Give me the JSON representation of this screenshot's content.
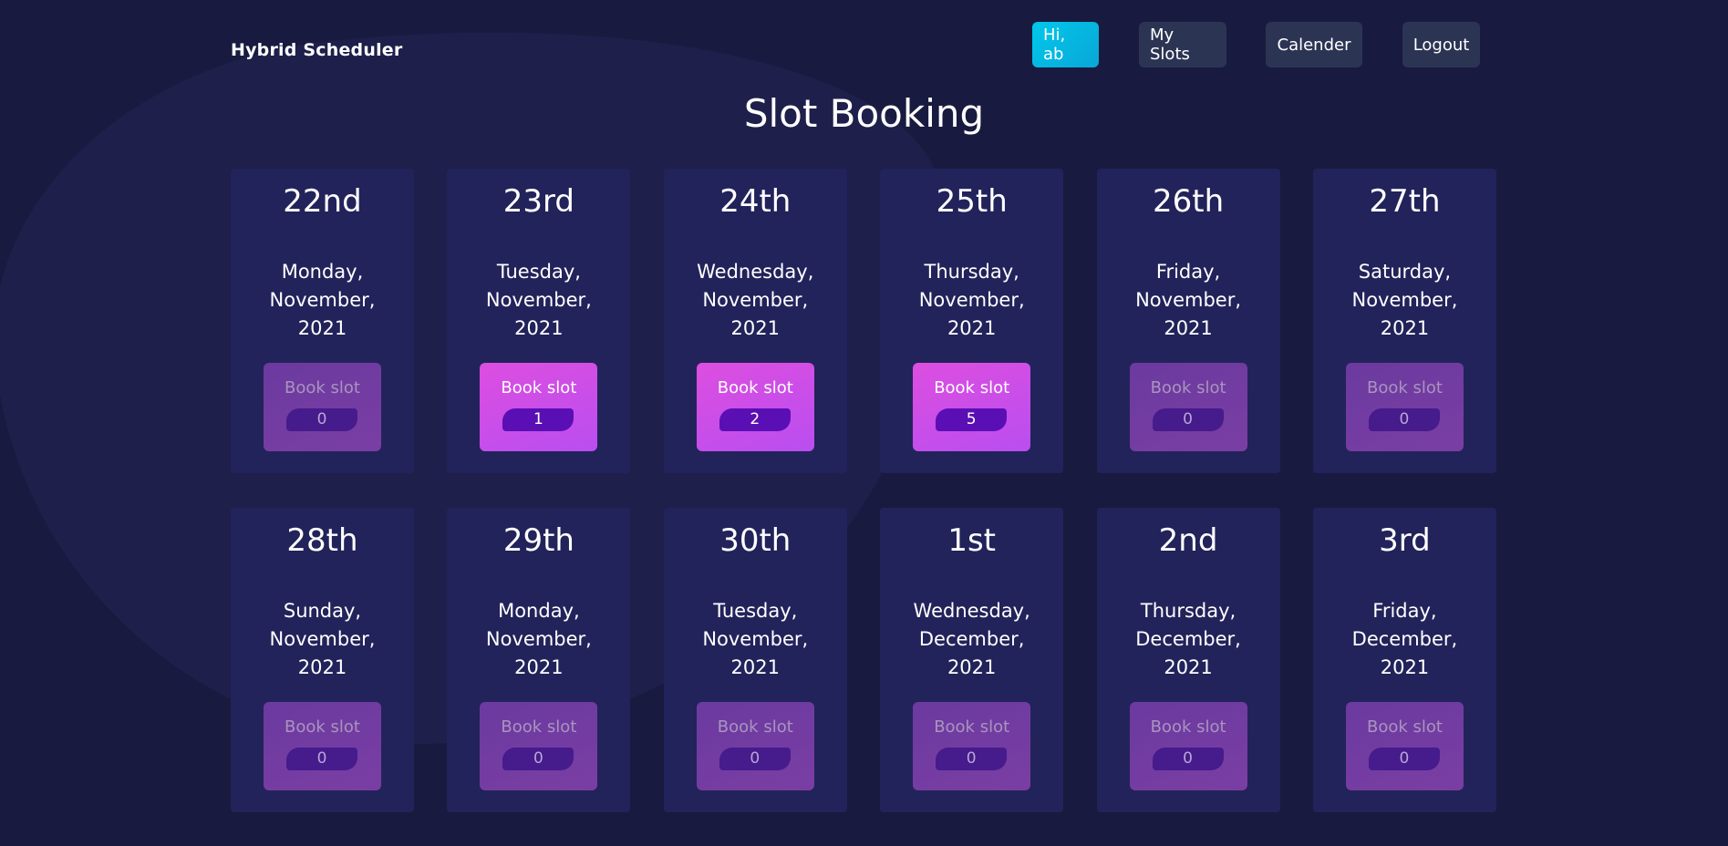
{
  "header": {
    "brand": "Hybrid Scheduler",
    "greeting": "Hi, ab",
    "my_slots": "My Slots",
    "calendar": "Calender",
    "logout": "Logout"
  },
  "page_title": "Slot Booking",
  "book_label": "Book slot",
  "colors": {
    "background": "#191a3f",
    "card": "#22235a",
    "greet_accent": "#00c8ea",
    "book_active": "#dd4ee0",
    "book_inactive": "#6b3aa0"
  },
  "days": [
    {
      "day": "22nd",
      "weekday": "Monday,",
      "month": "November,",
      "year": "2021",
      "count": "0",
      "active": false
    },
    {
      "day": "23rd",
      "weekday": "Tuesday,",
      "month": "November,",
      "year": "2021",
      "count": "1",
      "active": true
    },
    {
      "day": "24th",
      "weekday": "Wednesday,",
      "month": "November,",
      "year": "2021",
      "count": "2",
      "active": true
    },
    {
      "day": "25th",
      "weekday": "Thursday,",
      "month": "November,",
      "year": "2021",
      "count": "5",
      "active": true
    },
    {
      "day": "26th",
      "weekday": "Friday,",
      "month": "November,",
      "year": "2021",
      "count": "0",
      "active": false
    },
    {
      "day": "27th",
      "weekday": "Saturday,",
      "month": "November,",
      "year": "2021",
      "count": "0",
      "active": false
    },
    {
      "day": "28th",
      "weekday": "Sunday,",
      "month": "November,",
      "year": "2021",
      "count": "0",
      "active": false
    },
    {
      "day": "29th",
      "weekday": "Monday,",
      "month": "November,",
      "year": "2021",
      "count": "0",
      "active": false
    },
    {
      "day": "30th",
      "weekday": "Tuesday,",
      "month": "November,",
      "year": "2021",
      "count": "0",
      "active": false
    },
    {
      "day": "1st",
      "weekday": "Wednesday,",
      "month": "December,",
      "year": "2021",
      "count": "0",
      "active": false
    },
    {
      "day": "2nd",
      "weekday": "Thursday,",
      "month": "December,",
      "year": "2021",
      "count": "0",
      "active": false
    },
    {
      "day": "3rd",
      "weekday": "Friday,",
      "month": "December,",
      "year": "2021",
      "count": "0",
      "active": false
    }
  ]
}
